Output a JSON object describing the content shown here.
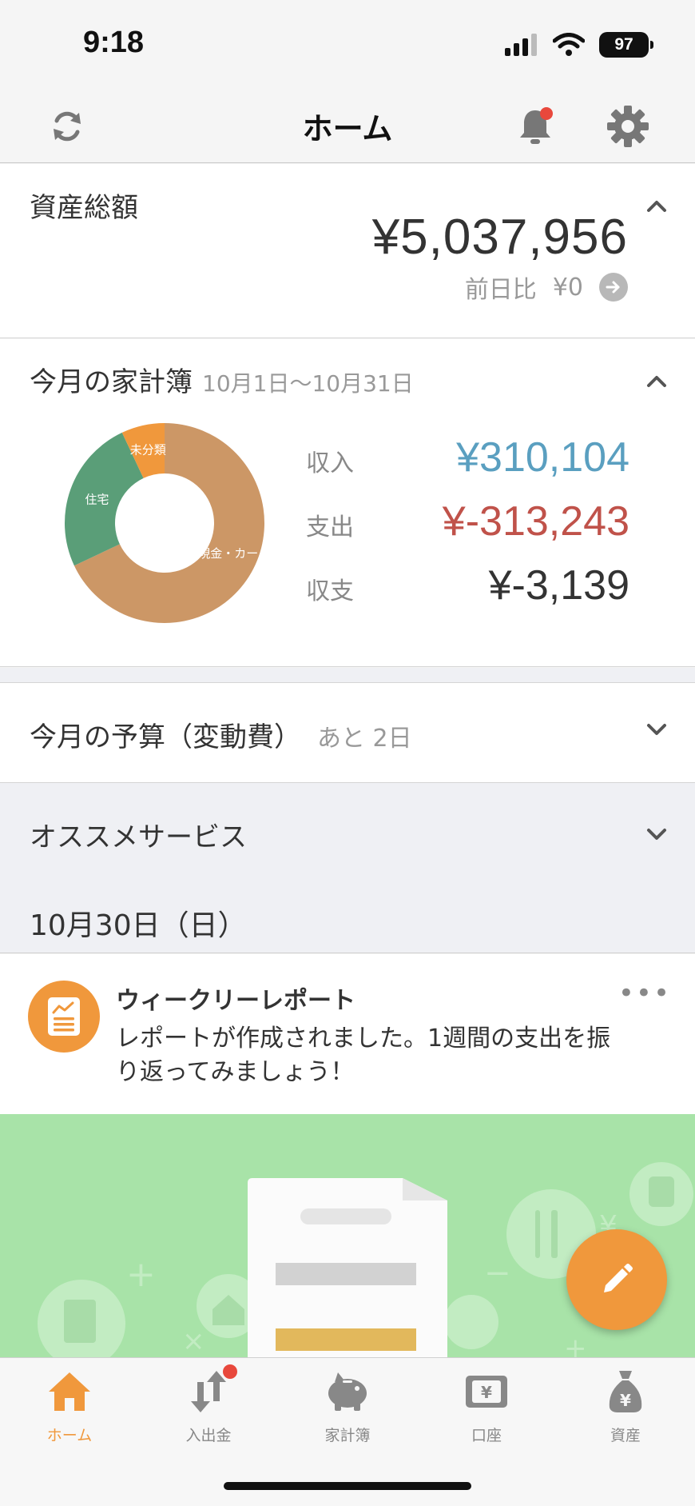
{
  "status_bar": {
    "time": "9:18",
    "battery": "97"
  },
  "nav": {
    "title": "ホーム"
  },
  "assets": {
    "title": "資産総額",
    "total": "¥5,037,956",
    "diff_label": "前日比",
    "diff_value": "¥0"
  },
  "household": {
    "title": "今月の家計簿",
    "period": "10月1日〜10月31日",
    "rows": [
      {
        "label": "収入",
        "value": "¥310,104",
        "color": "#5a9fc0"
      },
      {
        "label": "支出",
        "value": "¥-313,243",
        "color": "#c0524a"
      },
      {
        "label": "収支",
        "value": "¥-3,139",
        "color": "#333333"
      }
    ]
  },
  "chart_data": {
    "type": "pie",
    "style": "donut",
    "categories": [
      "現金・カード",
      "住宅",
      "未分類"
    ],
    "values": [
      68,
      25,
      7
    ],
    "colors": [
      "#cc9766",
      "#5a9e78",
      "#f0983c"
    ],
    "slice_labels": [
      "現金・カー",
      "住宅",
      "未分類"
    ]
  },
  "budget": {
    "title": "今月の予算（変動費）",
    "note": "あと 2日"
  },
  "recommend": {
    "title": "オススメサービス"
  },
  "timeline": {
    "date": "10月30日（日）",
    "notice_title": "ウィークリーレポート",
    "notice_body": "レポートが作成されました。1週間の支出を振り返ってみましょう！",
    "more": "•••"
  },
  "tabs": [
    {
      "label": "ホーム",
      "icon": "home-icon",
      "active": true
    },
    {
      "label": "入出金",
      "icon": "transfer-icon",
      "badge": true
    },
    {
      "label": "家計簿",
      "icon": "piggy-bank-icon"
    },
    {
      "label": "口座",
      "icon": "wallet-icon"
    },
    {
      "label": "資産",
      "icon": "money-bag-icon"
    }
  ],
  "colors": {
    "accent": "#f0983c",
    "badge": "#e8483c",
    "banner": "#a8e3a8"
  }
}
